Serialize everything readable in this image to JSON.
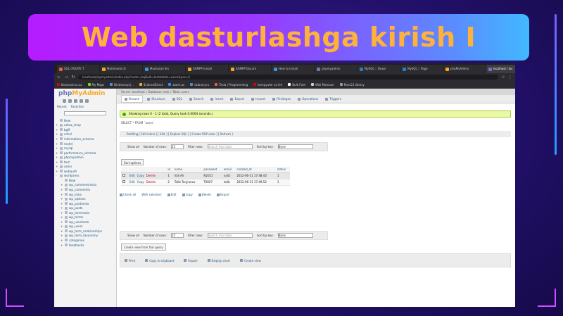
{
  "banner": {
    "title": "Web dasturlashga kirish I"
  },
  "browser": {
    "tabs": [
      {
        "label": "SQL CREATE T",
        "color": "#e85a4f"
      },
      {
        "label": "Multimedia D",
        "color": "#f5a623"
      },
      {
        "label": "Madrasah Ilm",
        "color": "#4a90d9"
      },
      {
        "label": "XAMPP Install",
        "color": "#f5a623"
      },
      {
        "label": "XAMPP Docum",
        "color": "#f5a623"
      },
      {
        "label": "How to install",
        "color": "#4a90d9"
      },
      {
        "label": "phpmyadmin",
        "color": "#6c78af"
      },
      {
        "label": "MySQL :: Down",
        "color": "#2f7bbf"
      },
      {
        "label": "MySQL :: Page",
        "color": "#2f7bbf"
      },
      {
        "label": "phpMyAdmin",
        "color": "#f5a623"
      },
      {
        "label": "localhost / loc",
        "color": "#6c78af",
        "active": true
      }
    ],
    "new_tab": "+",
    "omnibox": "localhost/phpmyadmin/index.php?route=/sql&db=test&table=users&pos=0",
    "bookmarks": [
      {
        "label": "Koronavirus.uz",
        "color": "#d0021b"
      },
      {
        "label": "My Maps",
        "color": "#7ed321"
      },
      {
        "label": "Dictionary.tj ..",
        "color": "#4a90d9"
      },
      {
        "label": "ScienceDirect",
        "color": "#f5a623"
      },
      {
        "label": "zoom.us",
        "color": "#2d8cff"
      },
      {
        "label": "eLibrary.ru",
        "color": "#4a90d9"
      },
      {
        "label": "Tesla | Programming",
        "color": "#e85a4f"
      },
      {
        "label": "kompyuter va ilm",
        "color": "#d0021b"
      },
      {
        "label": "Bulk Font",
        "color": "#ffffff"
      },
      {
        "label": "Wiki Mansoor",
        "color": "#cccccc"
      },
      {
        "label": "Marc21 library",
        "color": "#9b9b9b"
      }
    ]
  },
  "pma": {
    "logo_php": "php",
    "logo_admin": "MyAdmin",
    "recent": "Recent",
    "favorites": "Favorites",
    "tree": [
      {
        "label": "New",
        "level": 1,
        "exp": ""
      },
      {
        "label": "arbuz_shop",
        "level": 1,
        "exp": "+"
      },
      {
        "label": "bgff",
        "level": 1,
        "exp": "+"
      },
      {
        "label": "cdcol",
        "level": 1,
        "exp": "+"
      },
      {
        "label": "information_schema",
        "level": 1,
        "exp": "+"
      },
      {
        "label": "mohd",
        "level": 1,
        "exp": "+"
      },
      {
        "label": "mysql",
        "level": 1,
        "exp": "+"
      },
      {
        "label": "performance_schema",
        "level": 1,
        "exp": "+"
      },
      {
        "label": "phpmyadmin",
        "level": 1,
        "exp": "+"
      },
      {
        "label": "test",
        "level": 1,
        "exp": "+"
      },
      {
        "label": "users",
        "level": 1,
        "exp": "+"
      },
      {
        "label": "webauth",
        "level": 1,
        "exp": "+"
      },
      {
        "label": "wordpress",
        "level": 1,
        "exp": "-"
      },
      {
        "label": "New",
        "level": 2,
        "exp": ""
      },
      {
        "label": "wp_commentmeta",
        "level": 2,
        "exp": "+"
      },
      {
        "label": "wp_comments",
        "level": 2,
        "exp": "+"
      },
      {
        "label": "wp_links",
        "level": 2,
        "exp": "+"
      },
      {
        "label": "wp_options",
        "level": 2,
        "exp": "+"
      },
      {
        "label": "wp_postmeta",
        "level": 2,
        "exp": "+"
      },
      {
        "label": "wp_posts",
        "level": 2,
        "exp": "+"
      },
      {
        "label": "wp_termmeta",
        "level": 2,
        "exp": "+"
      },
      {
        "label": "wp_terms",
        "level": 2,
        "exp": "+"
      },
      {
        "label": "wp_usermeta",
        "level": 2,
        "exp": "+"
      },
      {
        "label": "wp_users",
        "level": 2,
        "exp": "+"
      },
      {
        "label": "wp_term_relationships",
        "level": 2,
        "exp": "+"
      },
      {
        "label": "wp_term_taxonomy",
        "level": 2,
        "exp": "+"
      },
      {
        "label": "categories",
        "level": 2,
        "exp": "+"
      },
      {
        "label": "feedbacks",
        "level": 2,
        "exp": "+"
      }
    ],
    "breadcrumb": "Server: localhost » Database: test » Table: users",
    "menu": [
      "Browse",
      "Structure",
      "SQL",
      "Search",
      "Insert",
      "Export",
      "Import",
      "Privileges",
      "Operations",
      "Triggers"
    ],
    "success_msg": "Showing rows 0 - 1 (2 total, Query took 0.0004 seconds.)",
    "sql_query": "SELECT * FROM `users`",
    "profiling": "Profiling [ Edit inline ] [ Edit ] [ Explain SQL ] [ Create PHP code ] [ Refresh ]",
    "filter_top": {
      "show_all": "Show all",
      "rows_label": "Number of rows:",
      "rows_value": "25",
      "filter_label": "Filter rows:",
      "filter_placeholder": "Search this table",
      "sort_label": "Sort by key:",
      "sort_value": "None"
    },
    "sort_btn": "Sort options",
    "grid": {
      "columns": [
        "",
        "",
        "id",
        "name",
        "password",
        "email",
        "created_at",
        "status"
      ],
      "rows": [
        {
          "id": "1",
          "name": "Vali Ali",
          "password": "N2021",
          "email": "vali1",
          "created_at": "2022-06-11 17:48:43",
          "status": "1"
        },
        {
          "id": "2",
          "name": "Tolib Turg'unov",
          "password": "T0607",
          "email": "tolib",
          "created_at": "2022-06-11 17:49:52",
          "status": "1"
        }
      ],
      "actions": {
        "edit": "Edit",
        "copy": "Copy",
        "delete": "Delete"
      }
    },
    "bulk": [
      "Check all",
      "With selected:",
      "Edit",
      "Copy",
      "Delete",
      "Export"
    ],
    "create_view": "Create view from this query",
    "query_ops": [
      "Print",
      "Copy to clipboard",
      "Export",
      "Display chart",
      "Create view"
    ]
  }
}
